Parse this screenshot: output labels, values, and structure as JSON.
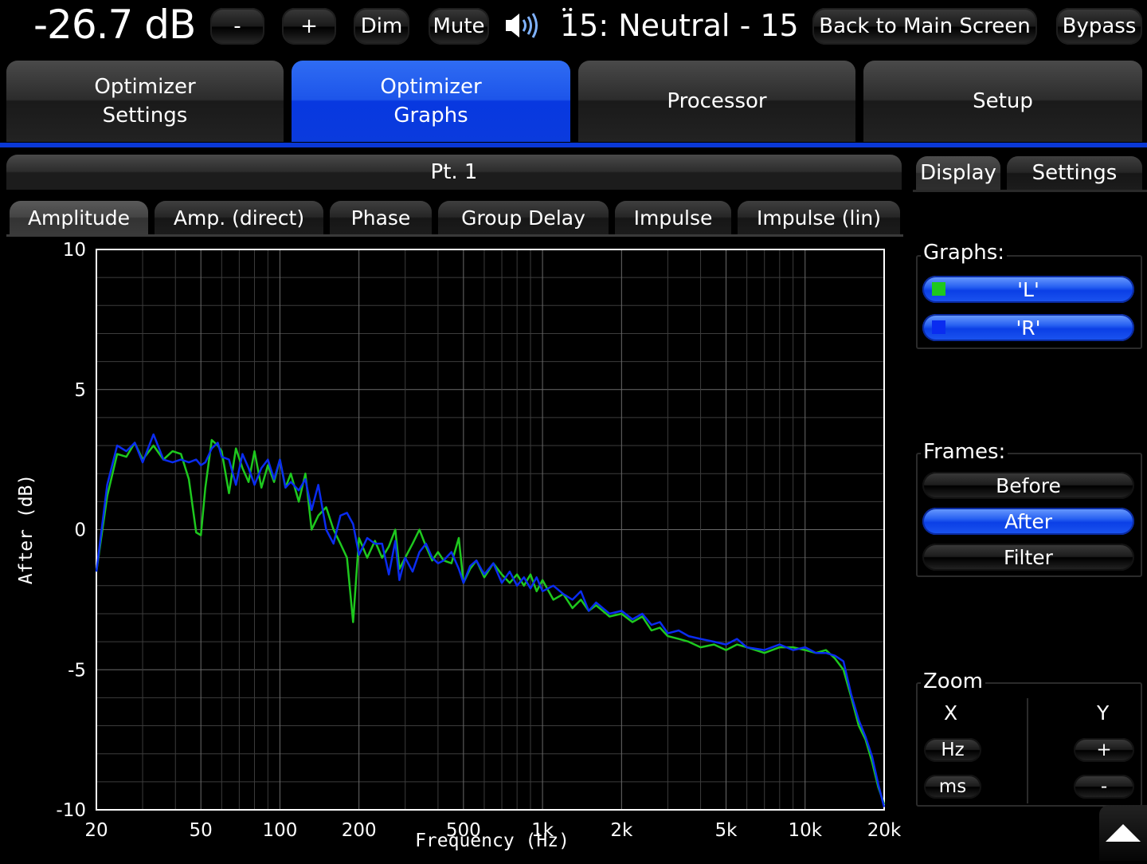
{
  "topbar": {
    "volume": "-26.7 dB",
    "minus_label": "-",
    "plus_label": "+",
    "dim_label": "Dim",
    "mute_label": "Mute",
    "speaker_icon": "speaker-volume-icon",
    "preset": "15: Neutral - 15",
    "back_label": "Back to Main Screen",
    "bypass_label": "Bypass"
  },
  "main_tabs": [
    {
      "label": "Optimizer\nSettings",
      "active": false
    },
    {
      "label": "Optimizer\nGraphs",
      "active": true
    },
    {
      "label": "Processor",
      "active": false
    },
    {
      "label": "Setup",
      "active": false
    }
  ],
  "panel_title": "Pt. 1",
  "graph_tabs": [
    "Amplitude",
    "Amp. (direct)",
    "Phase",
    "Group Delay",
    "Impulse",
    "Impulse (lin)"
  ],
  "active_graph_tab": "Amplitude",
  "right_tabs": [
    "Display",
    "Settings"
  ],
  "active_right_tab": "Display",
  "graphs": {
    "label": "Graphs:",
    "items": [
      {
        "label": "'L'",
        "color": "#1ec81e"
      },
      {
        "label": "'R'",
        "color": "#0a2cf0"
      }
    ]
  },
  "frames": {
    "label": "Frames:",
    "items": [
      "Before",
      "After",
      "Filter"
    ],
    "selected": "After"
  },
  "zoom": {
    "label": "Zoom",
    "x_label": "X",
    "y_label": "Y",
    "x_buttons": [
      "Hz",
      "ms"
    ],
    "y_buttons": [
      "+",
      "-"
    ]
  },
  "scroll_icon": "triangle-up-icon",
  "colors": {
    "accent_blue": "#0a38d6",
    "series_L": "#1ec81e",
    "series_R": "#0a2cf0"
  },
  "chart_data": {
    "type": "line",
    "xlabel": "Frequency (Hz)",
    "ylabel": "After (dB)",
    "xscale": "log",
    "xlim": [
      20,
      20000
    ],
    "ylim": [
      -10,
      10
    ],
    "xticks": [
      20,
      50,
      100,
      200,
      500,
      1000,
      2000,
      5000,
      10000,
      20000
    ],
    "xticklabels": [
      "20",
      "50",
      "100",
      "200",
      "500",
      "1k",
      "2k",
      "5k",
      "10k",
      "20k"
    ],
    "yticks": [
      10,
      5,
      0,
      -5,
      -10
    ],
    "yticklabels": [
      "10",
      "5",
      "0",
      "-5",
      "-10"
    ],
    "grid": true,
    "series": [
      {
        "name": "'L'",
        "color": "#1ec81e",
        "x": [
          20,
          22,
          24,
          26,
          28,
          30,
          33,
          36,
          39,
          42,
          45,
          48,
          50,
          52,
          55,
          58,
          60,
          64,
          68,
          72,
          76,
          80,
          85,
          90,
          95,
          100,
          105,
          110,
          118,
          125,
          132,
          140,
          150,
          160,
          170,
          180,
          190,
          200,
          215,
          230,
          245,
          260,
          275,
          285,
          300,
          320,
          340,
          360,
          380,
          400,
          420,
          450,
          480,
          500,
          530,
          560,
          600,
          650,
          700,
          750,
          800,
          850,
          900,
          950,
          1000,
          1100,
          1200,
          1300,
          1400,
          1500,
          1600,
          1800,
          2000,
          2200,
          2400,
          2600,
          2800,
          3000,
          3300,
          3600,
          4000,
          4500,
          5000,
          5500,
          6000,
          7000,
          8000,
          9000,
          10000,
          11000,
          12000,
          13000,
          14000,
          15000,
          16000,
          17000,
          18000,
          19000,
          20000
        ],
        "y": [
          -1.5,
          1.2,
          2.7,
          2.6,
          3.1,
          2.5,
          3.0,
          2.5,
          2.8,
          2.7,
          1.8,
          -0.1,
          -0.2,
          1.5,
          3.2,
          3.0,
          2.8,
          1.3,
          2.9,
          2.2,
          1.7,
          2.8,
          1.5,
          2.3,
          1.7,
          2.5,
          1.5,
          2.0,
          1.0,
          2.0,
          0.0,
          0.5,
          0.8,
          0.0,
          -0.5,
          -1.0,
          -3.3,
          -0.3,
          -1.0,
          -0.4,
          -1.0,
          -0.6,
          0.0,
          -1.4,
          -1.0,
          -0.5,
          0.0,
          -0.6,
          -1.1,
          -0.8,
          -1.1,
          -1.2,
          -0.3,
          -1.9,
          -1.4,
          -1.1,
          -1.7,
          -1.2,
          -1.6,
          -1.9,
          -1.6,
          -2.0,
          -1.6,
          -2.2,
          -1.8,
          -2.5,
          -2.3,
          -2.8,
          -2.5,
          -2.9,
          -2.7,
          -3.1,
          -3.0,
          -3.3,
          -3.1,
          -3.6,
          -3.5,
          -3.8,
          -3.9,
          -4.0,
          -4.2,
          -4.1,
          -4.3,
          -4.1,
          -4.2,
          -4.4,
          -4.2,
          -4.2,
          -4.3,
          -4.4,
          -4.3,
          -4.6,
          -5.0,
          -6.0,
          -7.0,
          -7.5,
          -8.3,
          -9.2,
          -9.8
        ]
      },
      {
        "name": "'R'",
        "color": "#0a2cf0",
        "x": [
          20,
          22,
          24,
          26,
          28,
          30,
          33,
          36,
          39,
          42,
          45,
          48,
          50,
          52,
          55,
          58,
          60,
          64,
          68,
          72,
          76,
          80,
          85,
          90,
          95,
          100,
          105,
          110,
          118,
          125,
          132,
          140,
          150,
          160,
          170,
          180,
          190,
          200,
          215,
          230,
          245,
          260,
          275,
          285,
          300,
          320,
          340,
          360,
          380,
          400,
          420,
          450,
          480,
          500,
          530,
          560,
          600,
          650,
          700,
          750,
          800,
          850,
          900,
          950,
          1000,
          1100,
          1200,
          1300,
          1400,
          1500,
          1600,
          1800,
          2000,
          2200,
          2400,
          2600,
          2800,
          3000,
          3300,
          3600,
          4000,
          4500,
          5000,
          5500,
          6000,
          7000,
          8000,
          9000,
          10000,
          11000,
          12000,
          13000,
          14000,
          15000,
          16000,
          17000,
          18000,
          19000,
          20000
        ],
        "y": [
          -1.5,
          1.6,
          3.0,
          2.8,
          3.1,
          2.4,
          3.4,
          2.5,
          2.4,
          2.5,
          2.4,
          2.5,
          2.3,
          2.4,
          2.9,
          3.1,
          2.6,
          2.5,
          1.6,
          2.7,
          2.2,
          1.6,
          2.2,
          2.5,
          1.8,
          2.5,
          1.5,
          1.7,
          1.4,
          1.8,
          0.7,
          1.6,
          0.0,
          -0.5,
          0.5,
          0.6,
          0.2,
          -0.9,
          -0.3,
          -0.5,
          -0.5,
          -1.6,
          -0.4,
          -1.8,
          -1.0,
          -1.5,
          -0.8,
          -0.5,
          -1.0,
          -1.2,
          -1.1,
          -0.8,
          -1.4,
          -1.9,
          -1.3,
          -1.1,
          -1.6,
          -1.2,
          -1.9,
          -1.5,
          -2.0,
          -1.7,
          -2.1,
          -1.7,
          -2.2,
          -2.0,
          -2.3,
          -2.5,
          -2.2,
          -2.9,
          -2.6,
          -3.0,
          -2.9,
          -3.2,
          -3.0,
          -3.4,
          -3.3,
          -3.7,
          -3.6,
          -3.8,
          -3.9,
          -4.0,
          -4.1,
          -3.9,
          -4.2,
          -4.3,
          -4.1,
          -4.3,
          -4.2,
          -4.4,
          -4.4,
          -4.5,
          -4.7,
          -5.9,
          -6.8,
          -7.4,
          -8.1,
          -9.1,
          -9.9
        ]
      }
    ]
  }
}
